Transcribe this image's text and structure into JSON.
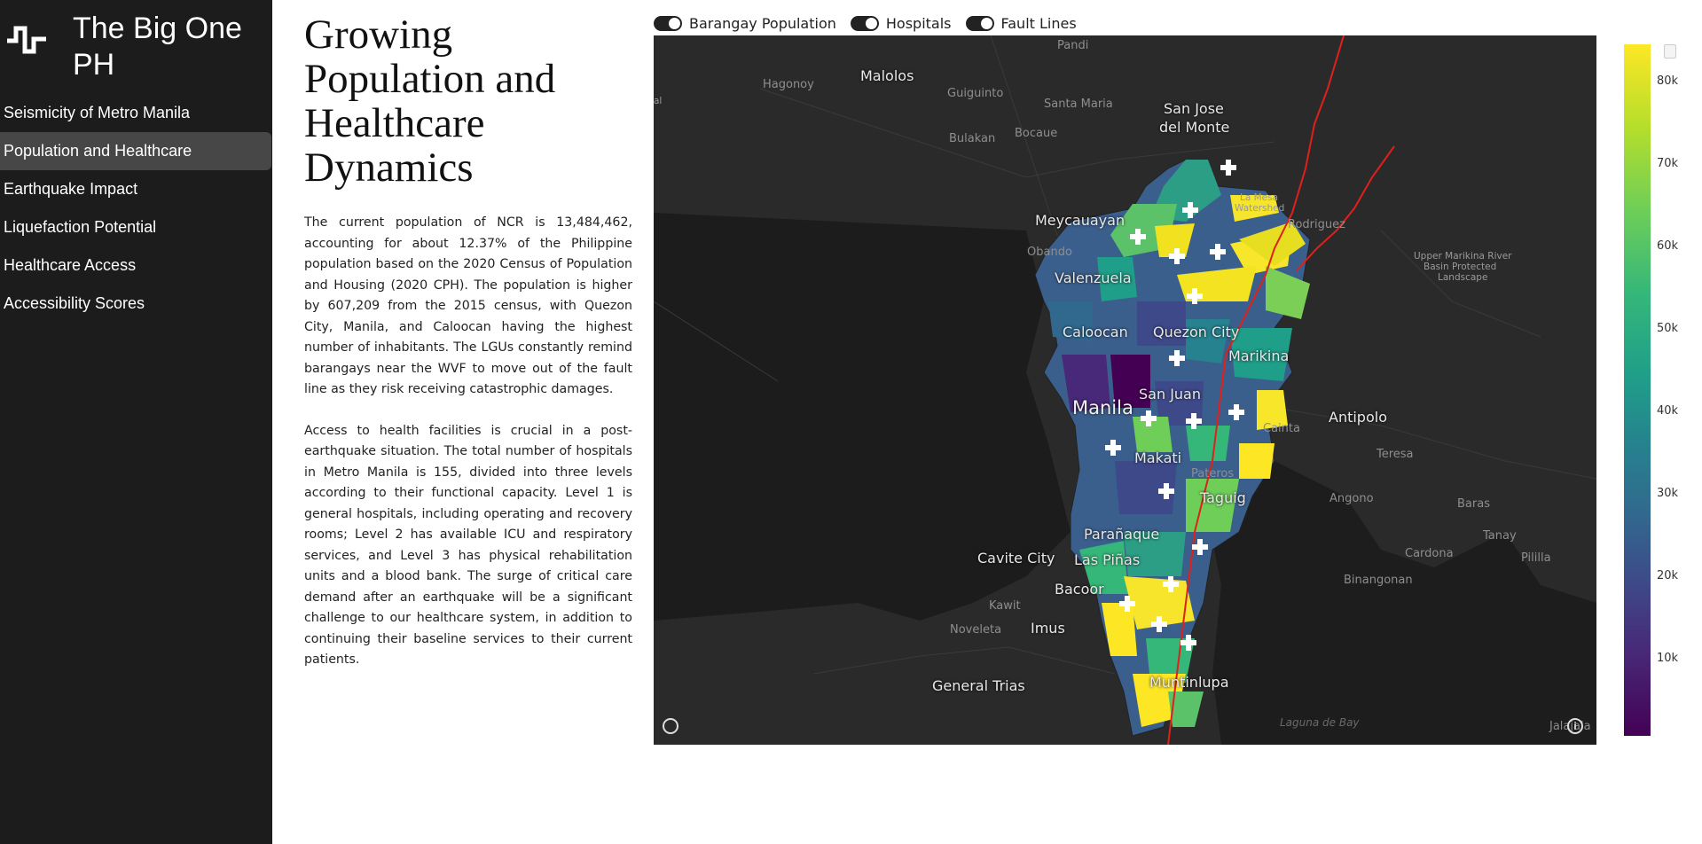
{
  "app": {
    "title": "The Big One PH",
    "logo_icon": "seismograph-icon"
  },
  "nav": {
    "items": [
      {
        "label": "Seismicity of Metro Manila",
        "active": false
      },
      {
        "label": "Population and Healthcare",
        "active": true
      },
      {
        "label": "Earthquake Impact",
        "active": false
      },
      {
        "label": "Liquefaction Potential",
        "active": false
      },
      {
        "label": "Healthcare Access",
        "active": false
      },
      {
        "label": "Accessibility Scores",
        "active": false
      }
    ]
  },
  "article": {
    "heading": "Growing Population and Healthcare Dynamics",
    "paragraph_1": "The current population of NCR is 13,484,462, accounting for about 12.37% of the Philippine population based on the 2020 Census of Population and Housing (2020 CPH). The population is higher by 607,209 from the 2015 census, with Quezon City, Manila, and Caloocan having the highest number of inhabitants. The LGUs constantly remind barangays near the WVF to move out of the fault line as they risk receiving catastrophic damages.",
    "paragraph_2": "Access to health facilities is crucial in a post-earthquake situation. The total number of hospitals in Metro Manila is 155, divided into three levels according to their functional capacity. Level 1 is general hospitals, including operating and recovery rooms; Level 2 has available ICU and respiratory services, and Level 3 has physical rehabilitation units and a blood bank. The surge of critical care demand after an earthquake will be a significant challenge to our healthcare system, in addition to continuing their baseline services to their current patients."
  },
  "layers": [
    {
      "label": "Barangay Population",
      "on": true
    },
    {
      "label": "Hospitals",
      "on": true
    },
    {
      "label": "Fault Lines",
      "on": true
    }
  ],
  "map": {
    "places": {
      "pandi": "Pandi",
      "malolos": "Malolos",
      "hagonoy": "Hagonoy",
      "guiguinto": "Guiguinto",
      "santa_maria": "Santa Maria",
      "san_jose": "San Jose",
      "del_monte": "del Monte",
      "bulakan": "Bulakan",
      "bocaue": "Bocaue",
      "meycauayan": "Meycauayan",
      "obando": "Obando",
      "la_mesa": "La Mesa",
      "watershed": "Watershed",
      "rodriguez": "Rodriguez",
      "upper_marikina_1": "Upper Marikina River",
      "upper_marikina_2": "Basin Protected",
      "upper_marikina_3": "Landscape",
      "valenzuela": "Valenzuela",
      "caloocan": "Caloocan",
      "quezon_city": "Quezon City",
      "marikina": "Marikina",
      "san_juan": "San Juan",
      "manila": "Manila",
      "antipolo": "Antipolo",
      "cainta": "Cainta",
      "teresa": "Teresa",
      "makati": "Makati",
      "pateros": "Pateros",
      "taguig": "Taguig",
      "angono": "Angono",
      "baras": "Baras",
      "tanay": "Tanay",
      "paranaque": "Parañaque",
      "cavite_city": "Cavite City",
      "las_pinas": "Las Piñas",
      "cardona": "Cardona",
      "pililla": "Pililla",
      "binangonan": "Binangonan",
      "bacoor": "Bacoor",
      "kawit": "Kawit",
      "noveleta": "Noveleta",
      "imus": "Imus",
      "general_trias": "General Trias",
      "muntinlupa": "Muntinlupa",
      "laguna_de_bay": "Laguna de Bay",
      "jalajala": "Jalajala",
      "edge_al": "al"
    },
    "fault_color": "#e0201b",
    "hospital_marker": "plus-icon",
    "colorscale": "viridis"
  },
  "colorbar": {
    "ticks": [
      "80k",
      "70k",
      "60k",
      "50k",
      "40k",
      "30k",
      "20k",
      "10k"
    ],
    "min": 0,
    "max": 84000
  }
}
